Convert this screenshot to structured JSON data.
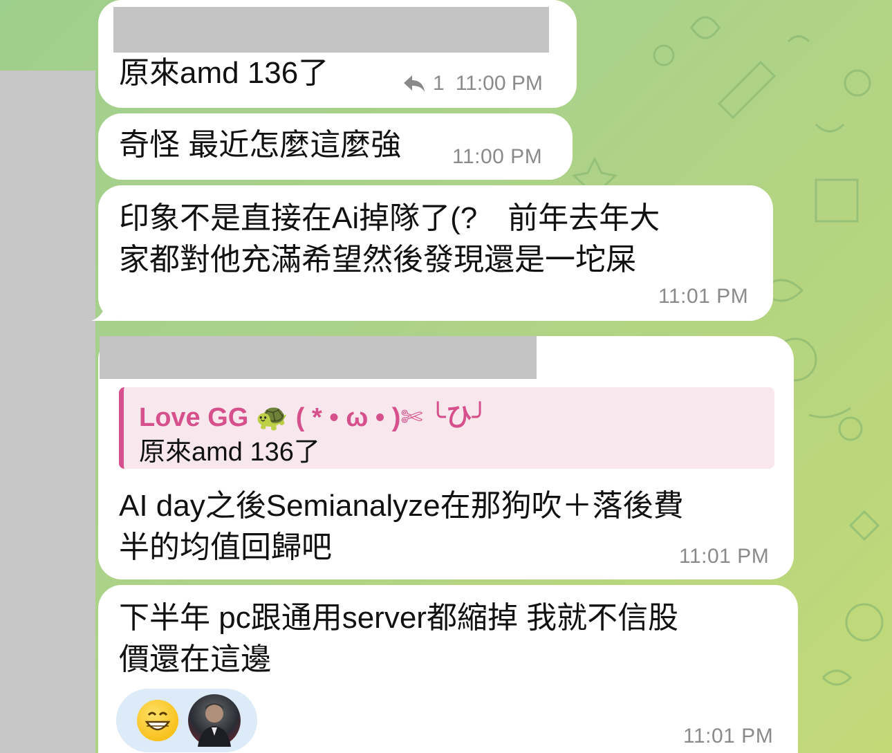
{
  "colors": {
    "bubble": "#ffffff",
    "timestamp": "#8a8a8a",
    "quote_accent": "#d6518b",
    "quote_bg": "#f8e8ee",
    "reaction_bg": "#dcebf7",
    "redacted": "#c4c4c4"
  },
  "messages": [
    {
      "text": "原來amd 136了",
      "reply_icon": "reply-arrow-icon",
      "reply_count": "1",
      "time": "11:00 PM"
    },
    {
      "text": "奇怪 最近怎麼這麼強",
      "time": "11:00 PM"
    },
    {
      "text": "印象不是直接在Ai掉隊了(?　前年去年大\n家都對他充滿希望然後發現還是一坨屎",
      "time": "11:01 PM"
    },
    {
      "quote": {
        "name": "Love GG 🐢 ( * • ω • )✄ ╰ひ╯",
        "text": "原來amd 136了"
      },
      "text": "AI day之後Semianalyze在那狗吹＋落後費\n半的均值回歸吧",
      "time": "11:01 PM"
    },
    {
      "text": "下半年 pc跟通用server都縮掉 我就不信股\n價還在這邊",
      "reactions": [
        "grinning-face-emoji",
        "user-avatar"
      ],
      "time": "11:01 PM"
    }
  ]
}
